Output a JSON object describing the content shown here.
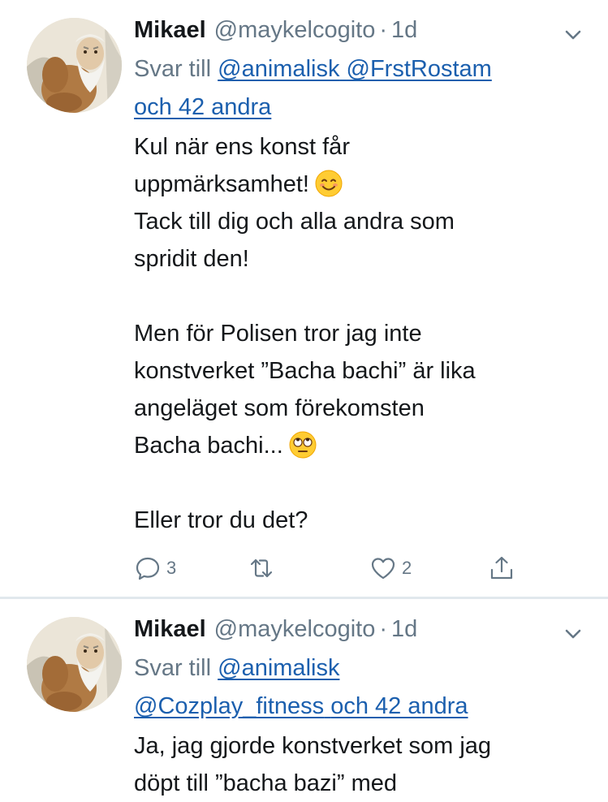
{
  "colors": {
    "link": "#1b5fae",
    "muted": "#657786",
    "text": "#14171a",
    "divider": "#e1e8ed"
  },
  "tweets": [
    {
      "author_name": "Mikael",
      "author_handle": "@maykelcogito",
      "separator": "·",
      "timestamp": "1d",
      "reply_prefix": "Svar till",
      "reply_mention_1": "@animalisk",
      "reply_mention_2": "@FrstRostam",
      "reply_others": "och 42 andra",
      "body_lines": [
        "Kul när ens konst får",
        "uppmärksamhet!",
        "Tack till dig och alla andra som",
        "spridit den!",
        "",
        "Men för Polisen tror jag inte",
        "konstverket ”Bacha bachi” är lika",
        "angeläget som förekomsten",
        "Bacha bachi...",
        "",
        "Eller tror du det?"
      ],
      "emoji_1": "smiling-face-emoji",
      "emoji_2": "eye-roll-emoji",
      "actions": {
        "reply_count": "3",
        "retweet_count": "",
        "like_count": "2"
      }
    },
    {
      "author_name": "Mikael",
      "author_handle": "@maykelcogito",
      "separator": "·",
      "timestamp": "1d",
      "reply_prefix": "Svar till",
      "reply_mention_1": "@animalisk",
      "reply_mention_2": "@Cozplay_fitness",
      "reply_others": "och 42 andra",
      "body_lines": [
        "Ja, jag gjorde konstverket som jag",
        "döpt till ”bacha bazi” med"
      ]
    }
  ]
}
